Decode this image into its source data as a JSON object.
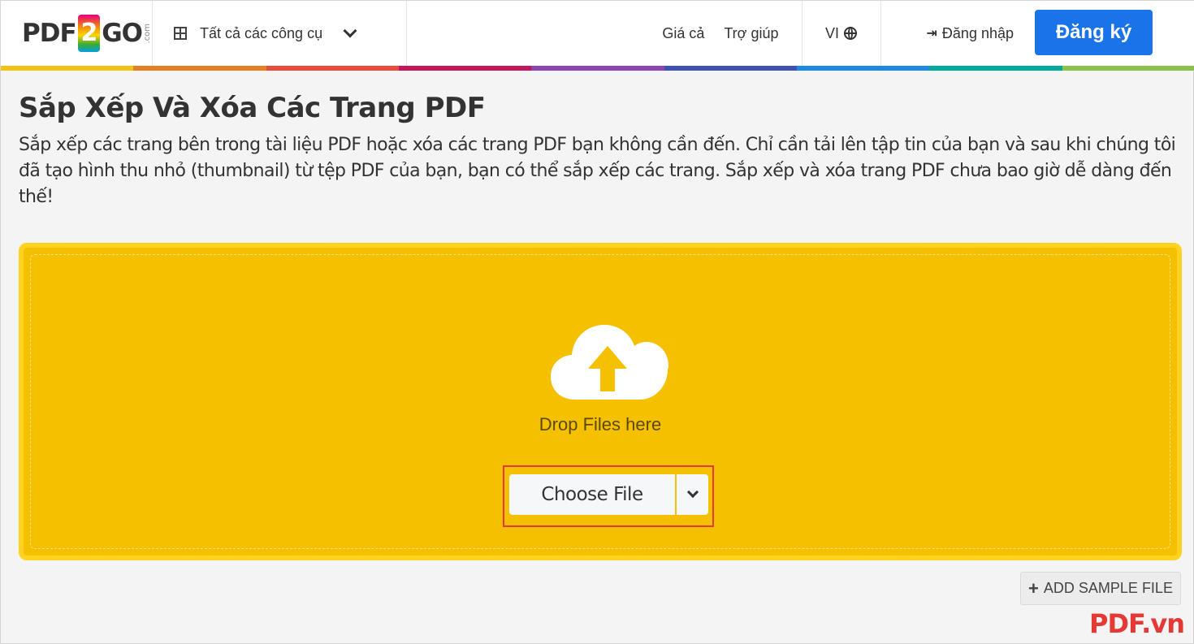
{
  "header": {
    "logo": {
      "left": "PDF",
      "digit": "2",
      "right": "GO",
      "suffix": ".com"
    },
    "tools_label": "Tất cả các công cụ",
    "nav": {
      "pricing": "Giá cả",
      "help": "Trợ giúp"
    },
    "lang": "VI",
    "login": "Đăng nhập",
    "signup": "Đăng ký"
  },
  "stripe_colors": [
    "#f1c40f",
    "#e67e22",
    "#e74c3c",
    "#c2185b",
    "#8e44ad",
    "#3f51b5",
    "#1e88e5",
    "#00a99d",
    "#8bc34a"
  ],
  "page": {
    "title": "Sắp Xếp Và Xóa Các Trang PDF",
    "description": "Sắp xếp các trang bên trong tài liệu PDF hoặc xóa các trang PDF bạn không cần đến. Chỉ cần tải lên tập tin của bạn và sau khi chúng tôi đã tạo hình thu nhỏ (thumbnail) từ tệp PDF của bạn, bạn có thể sắp xếp các trang. Sắp xếp và xóa trang PDF chưa bao giờ dễ dàng đến thế!"
  },
  "dropzone": {
    "drop_text": "Drop Files here",
    "choose_label": "Choose File",
    "color": "#f4c000"
  },
  "sample_label": "ADD SAMPLE FILE",
  "watermark": "PDF.vn"
}
